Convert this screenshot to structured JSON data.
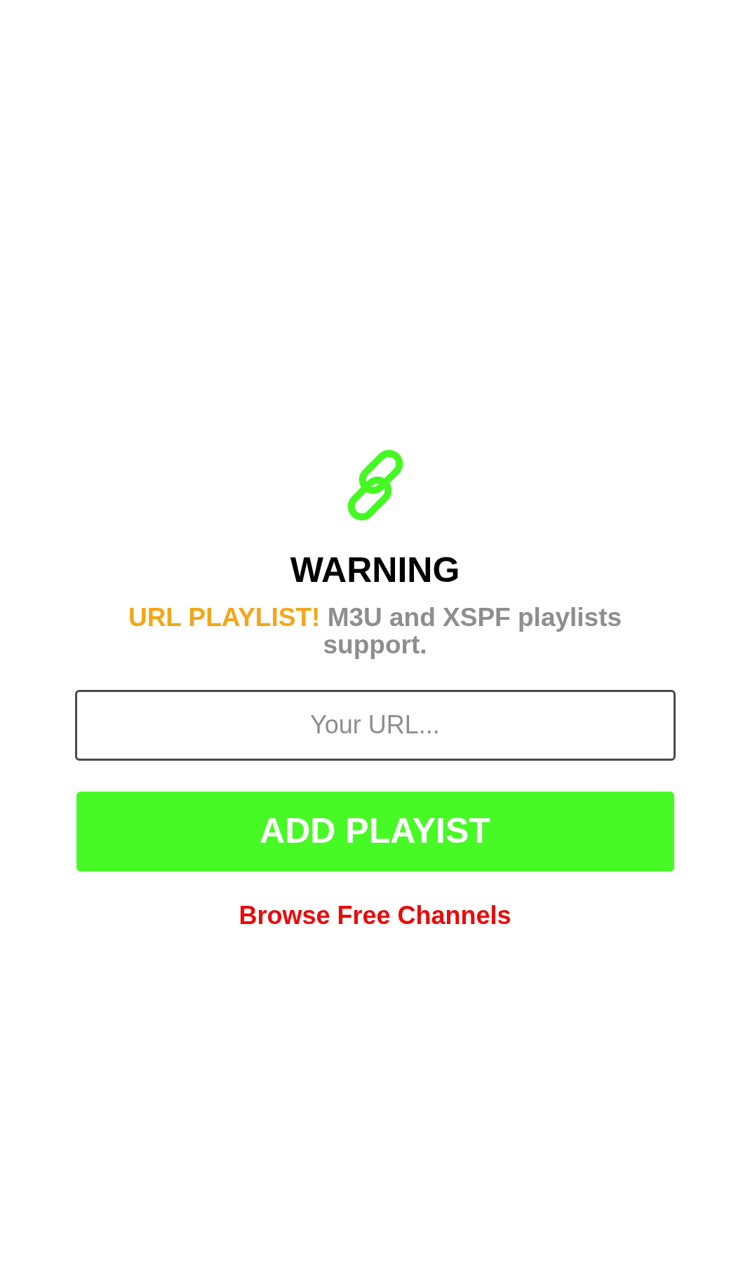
{
  "title": "WARNING",
  "subtitle": {
    "highlight": "URL PLAYLIST!",
    "text": "M3U and XSPF playlists support."
  },
  "url_field": {
    "placeholder": "Your URL..."
  },
  "add_button": {
    "label": "ADD PLAYIST"
  },
  "browse_link": {
    "label": "Browse Free Channels"
  }
}
